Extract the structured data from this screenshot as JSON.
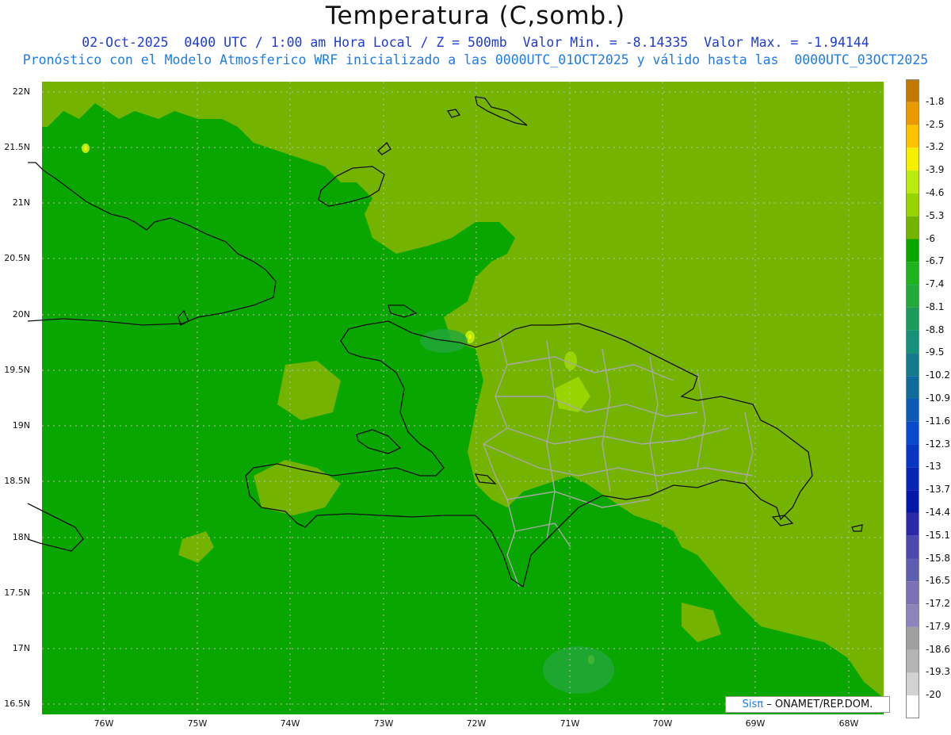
{
  "header": {
    "title": "Temperatura (C,somb.)",
    "line1": "02-Oct-2025  0400 UTC / 1:00 am Hora Local / Z = 500mb  Valor Min. = -8.14335  Valor Max. = -1.94144",
    "line2": "Pronóstico con el Modelo Atmosferico WRF inicializado a las 0000UTC_01OCT2025 y válido hasta las  0000UTC_03OCT2025"
  },
  "axes": {
    "lat_labels": [
      "22N",
      "21.5N",
      "21N",
      "20.5N",
      "20N",
      "19.5N",
      "19N",
      "18.5N",
      "18N",
      "17.5N",
      "17N",
      "16.5N"
    ],
    "lon_labels": [
      "76W",
      "75W",
      "74W",
      "73W",
      "72W",
      "71W",
      "70W",
      "69W",
      "68W"
    ]
  },
  "legend": {
    "labels": [
      "-1.8",
      "-2.5",
      "-3.2",
      "-3.9",
      "-4.6",
      "-5.3",
      "-6",
      "-6.7",
      "-7.4",
      "-8.1",
      "-8.8",
      "-9.5",
      "-10.2",
      "-10.9",
      "-11.6",
      "-12.3",
      "-13",
      "-13.7",
      "-14.4",
      "-15.1",
      "-15.8",
      "-16.5",
      "-17.2",
      "-17.9",
      "-18.6",
      "-19.3",
      "-20"
    ],
    "colors": [
      "#c07a00",
      "#e89a00",
      "#ffc400",
      "#f5f000",
      "#b8ec10",
      "#98d400",
      "#74b300",
      "#0aa600",
      "#1fb31f",
      "#22a83c",
      "#1e9a58",
      "#188f78",
      "#147a8a",
      "#106a9c",
      "#0c5ab4",
      "#0a4ac8",
      "#0836c0",
      "#0626b0",
      "#0418a8",
      "#2a2aa8",
      "#4a4aac",
      "#5e5eb0",
      "#7a72b4",
      "#8f84ba",
      "#a0a0a0",
      "#b4b4b4",
      "#d2d2d2",
      "#ffffff"
    ]
  },
  "map_colors": {
    "main_green": "#0aa600",
    "olive": "#74b300",
    "coast": "#111111",
    "border": "#a8a8a8",
    "grid": "#bcbcbc"
  },
  "credit": {
    "logo": "Sisπ",
    "text": "– ONAMET/REP.DOM."
  }
}
